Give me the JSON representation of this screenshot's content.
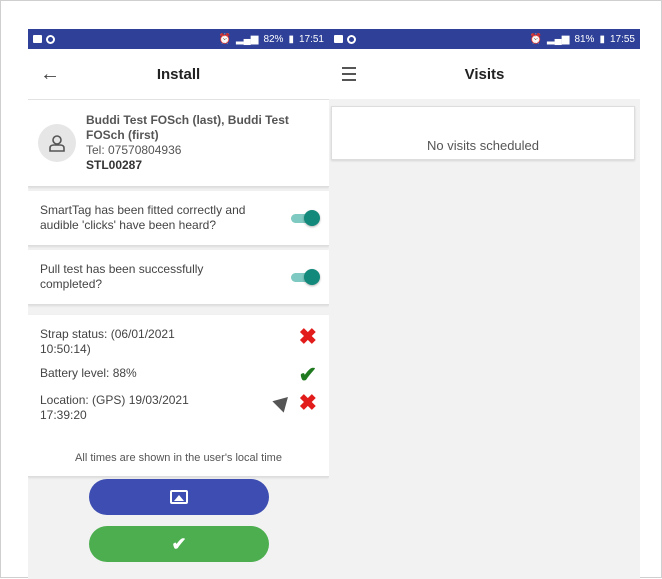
{
  "left": {
    "status": {
      "battery": "82%",
      "time": "17:51"
    },
    "title": "Install",
    "person": {
      "name": "Buddi Test FOSch (last), Buddi Test FOSch (first)",
      "tel": "Tel: 07570804936",
      "id": "STL00287"
    },
    "checks": [
      {
        "label": "SmartTag has been fitted correctly and audible 'clicks' have been heard?",
        "on": true
      },
      {
        "label": "Pull test has been successfully completed?",
        "on": true
      }
    ],
    "status_items": {
      "strap": "Strap status: (06/01/2021 10:50:14)",
      "battery": "Battery level: 88%",
      "location": "Location: (GPS) 19/03/2021 17:39:20"
    },
    "footer_note": "All times are shown in the user's local time",
    "buttons": {
      "photo_icon": "image-icon",
      "confirm_icon": "check-icon"
    }
  },
  "right": {
    "status": {
      "battery": "81%",
      "time": "17:55"
    },
    "title": "Visits",
    "empty_message": "No visits scheduled"
  },
  "colors": {
    "statusbar": "#2e4097",
    "toggle": "#12897b",
    "photo_button": "#3d4db1",
    "confirm_button": "#4cae4f",
    "error": "#e21b1b",
    "ok": "#1f7a1f"
  }
}
